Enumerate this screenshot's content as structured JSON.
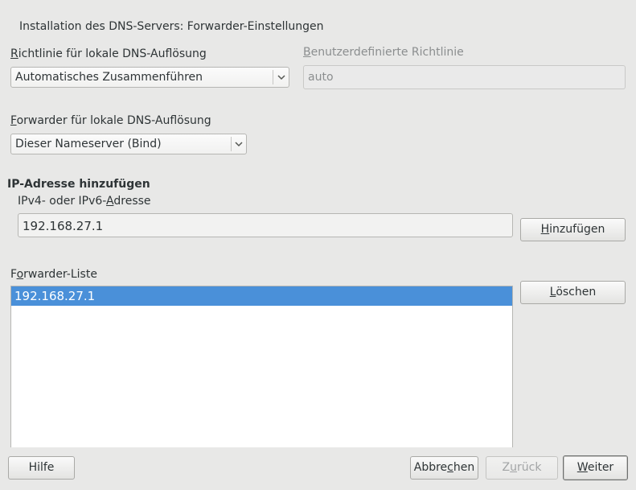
{
  "dialog": {
    "title": "Installation des DNS-Servers: Forwarder-Einstellungen"
  },
  "policy": {
    "label_mnemonic": "R",
    "label_rest": "ichtlinie für lokale DNS-Auflösung",
    "selected": "Automatisches Zusammenführen"
  },
  "custom_policy": {
    "label_mnemonic": "B",
    "label_rest": "enutzerdefinierte Richtlinie",
    "value": "auto"
  },
  "forwarder": {
    "label_mnemonic": "F",
    "label_rest": "orwarder für lokale DNS-Auflösung",
    "selected": "Dieser Nameserver (Bind)"
  },
  "add_ip": {
    "heading": "IP-Adresse hinzufügen",
    "field_label_pre": "IPv4- oder IPv6-",
    "field_label_mnemonic": "A",
    "field_label_rest": "dresse",
    "value": "192.168.27.1",
    "add_button_mnemonic": "H",
    "add_button_rest": "inzufügen"
  },
  "forwarder_list": {
    "label_pre": "F",
    "label_mnemonic": "o",
    "label_rest": "rwarder-Liste",
    "items": [
      "192.168.27.1"
    ],
    "delete_button_mnemonic": "L",
    "delete_button_rest": "öschen"
  },
  "footer": {
    "help": "Hilfe",
    "cancel_pre": "Abbre",
    "cancel_mnemonic": "c",
    "cancel_rest": "hen",
    "back_pre": "Z",
    "back_mnemonic": "u",
    "back_rest": "rück",
    "next_mnemonic": "W",
    "next_rest": "eiter"
  }
}
